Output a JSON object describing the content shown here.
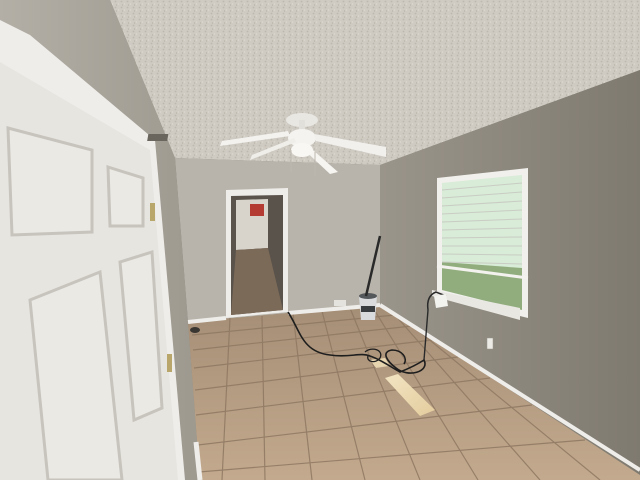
{
  "scene": {
    "type": "photo",
    "subject": "empty-room-interior",
    "icons": [
      "ceiling-fan-icon",
      "door-icon",
      "window-icon",
      "lamp-icon",
      "bucket-icon"
    ],
    "colors": {
      "ceiling": "#cfcbc3",
      "left_wall": "#a9a59c",
      "back_wall": "#b8b4ab",
      "right_wall": "#8f8a80",
      "floor_tile": "#b89f84",
      "floor_grout": "#8f7862",
      "door": "#e7e5e0",
      "trim": "#efedea",
      "window_glass": "#d8ecd8",
      "blinds": "#f3f2ee",
      "sunlight": "#f1dfb9",
      "cable": "#1e1e1e"
    }
  }
}
